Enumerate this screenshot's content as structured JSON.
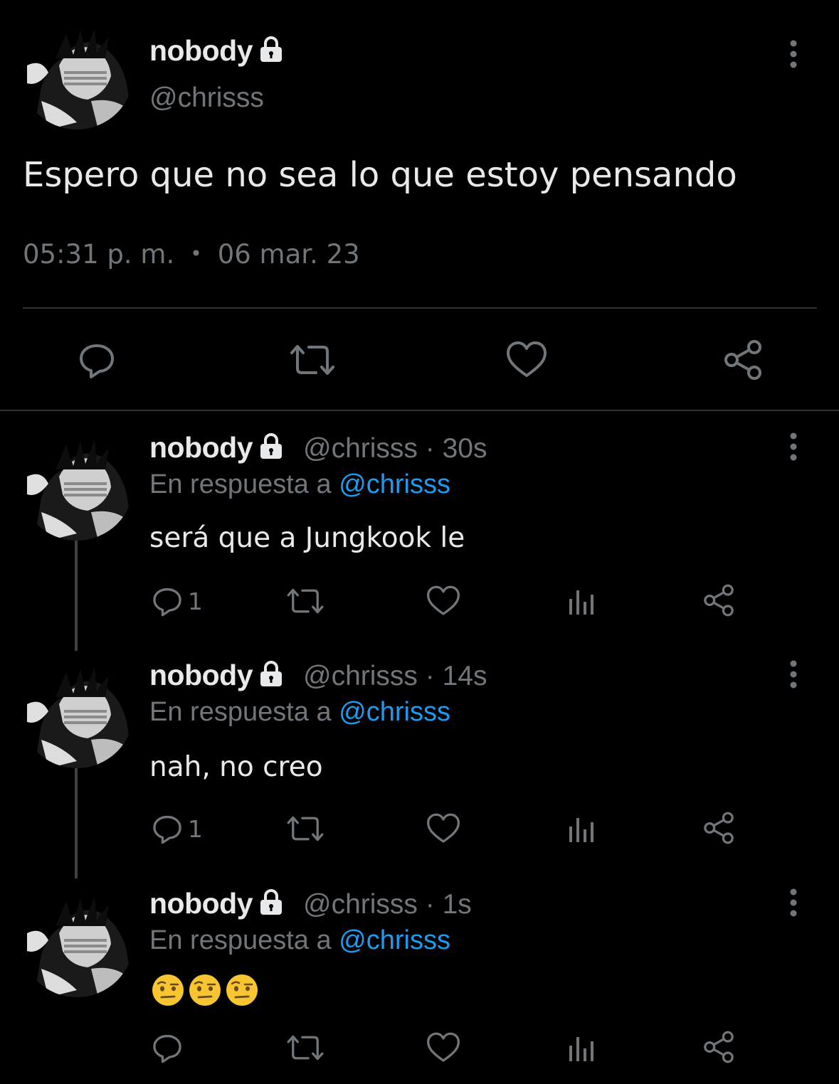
{
  "main_tweet": {
    "display_name": "nobody",
    "handle": "@chrisss",
    "text": "Espero que no sea lo que estoy pensando",
    "time": "05:31 p. m.",
    "separator": "•",
    "date": "06 mar. 23"
  },
  "replies": [
    {
      "display_name": "nobody",
      "handle_time": "@chrisss · 30s",
      "reply_prefix": "En respuesta a",
      "reply_to": "@chrisss",
      "text": "será que a Jungkook le",
      "reply_count": "1"
    },
    {
      "display_name": "nobody",
      "handle_time": "@chrisss · 14s",
      "reply_prefix": "En respuesta a",
      "reply_to": "@chrisss",
      "text": "nah, no creo",
      "reply_count": "1"
    },
    {
      "display_name": "nobody",
      "handle_time": "@chrisss · 1s",
      "reply_prefix": "En respuesta a",
      "reply_to": "@chrisss",
      "text": "🤨🤨🤨",
      "reply_count": ""
    }
  ],
  "colors": {
    "background": "#000000",
    "text": "#e7e9ea",
    "muted": "#71767b",
    "accent": "#1d9bf0",
    "divider": "#2f3336"
  },
  "icons": [
    "lock-icon",
    "more-icon",
    "reply-icon",
    "retweet-icon",
    "like-icon",
    "share-icon",
    "views-icon",
    "raised-eyebrow-emoji"
  ]
}
